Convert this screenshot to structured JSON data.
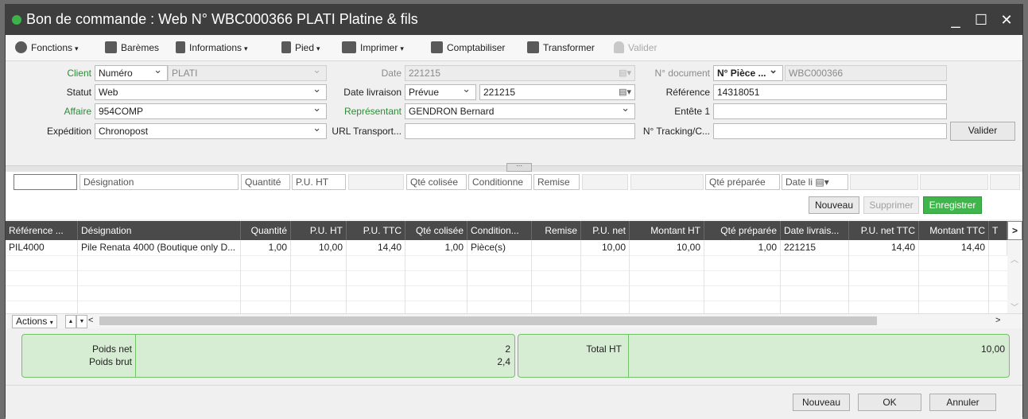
{
  "window": {
    "title": "Bon de commande : Web N° WBC000366 PLATI Platine & fils",
    "controls": {
      "minimize": "_",
      "maximize": "☐",
      "close": "✕"
    }
  },
  "toolbar": {
    "items": [
      {
        "label": "Fonctions",
        "icon": "gear-icon",
        "dropdown": "▾"
      },
      {
        "label": "Barèmes",
        "icon": "books-icon"
      },
      {
        "label": "Informations",
        "icon": "document-icon",
        "dropdown": "▾"
      },
      {
        "label": "Pied",
        "icon": "footer-icon",
        "dropdown": "▾"
      },
      {
        "label": "Imprimer",
        "icon": "printer-icon",
        "dropdown": "▾"
      },
      {
        "label": "Comptabiliser",
        "icon": "ledger-icon"
      },
      {
        "label": "Transformer",
        "icon": "transform-icon"
      },
      {
        "label": "Valider",
        "icon": "lock-icon"
      }
    ]
  },
  "form": {
    "client_label": "Client",
    "client_type": "Numéro",
    "client_value": "PLATI",
    "statut_label": "Statut",
    "statut_value": "Web",
    "affaire_label": "Affaire",
    "affaire_value": "954COMP",
    "expedition_label": "Expédition",
    "expedition_value": "Chronopost",
    "date_label": "Date",
    "date_value": "221215",
    "date_livraison_label": "Date livraison",
    "date_livraison_type": "Prévue",
    "date_livraison_value": "221215",
    "representant_label": "Représentant",
    "representant_value": "GENDRON Bernard",
    "url_label": "URL Transport...",
    "url_value": "",
    "ndoc_label": "N° document",
    "ndoc_type": "N° Pièce ...",
    "ndoc_value": "WBC000366",
    "reference_label": "Référence",
    "reference_value": "14318051",
    "entete_label": "Entête 1",
    "entete_value": "",
    "tracking_label": "N° Tracking/C...",
    "tracking_value": "",
    "valider_button": "Valider"
  },
  "splitter": {
    "handle": "⋯"
  },
  "edit_row": {
    "designation_placeholder": "Désignation",
    "quantite_placeholder": "Quantité",
    "puht_placeholder": "P.U. HT",
    "qte_colisee_placeholder": "Qté colisée",
    "conditionne_placeholder": "Conditionne",
    "remise_placeholder": "Remise",
    "qte_preparee_placeholder": "Qté préparée",
    "date_li_placeholder": "Date li"
  },
  "line_actions": {
    "nouveau": "Nouveau",
    "supprimer": "Supprimer",
    "enregistrer": "Enregistrer"
  },
  "grid": {
    "columns": [
      "Référence ...",
      "Désignation",
      "Quantité",
      "P.U. HT",
      "P.U. TTC",
      "Qté colisée",
      "Condition...",
      "Remise",
      "P.U. net",
      "Montant HT",
      "Qté préparée",
      "Date livrais...",
      "P.U. net TTC",
      "Montant TTC",
      "T"
    ],
    "rows": [
      [
        "PIL4000",
        "Pile Renata 4000 (Boutique only D...",
        "1,00",
        "10,00",
        "14,40",
        "1,00",
        "Pièce(s)",
        "",
        "10,00",
        "10,00",
        "1,00",
        "221215",
        "14,40",
        "14,40",
        ""
      ]
    ],
    "scroll_right": ">",
    "actions_label": "Actions",
    "nav_up": "▲",
    "nav_down": "▼",
    "nav_left": "<",
    "nav_right": ">"
  },
  "totals": {
    "poids_net_label": "Poids net",
    "poids_net_value": "2",
    "poids_brut_label": "Poids brut",
    "poids_brut_value": "2,4",
    "total_ht_label": "Total HT",
    "total_ht_value": "10,00"
  },
  "footer": {
    "nouveau": "Nouveau",
    "ok": "OK",
    "annuler": "Annuler"
  },
  "colors": {
    "accent_green": "#3fb54b",
    "titlebar": "#3e3e3e",
    "grid_header": "#4a4a4a",
    "panel_green": "#d6ecd3"
  }
}
